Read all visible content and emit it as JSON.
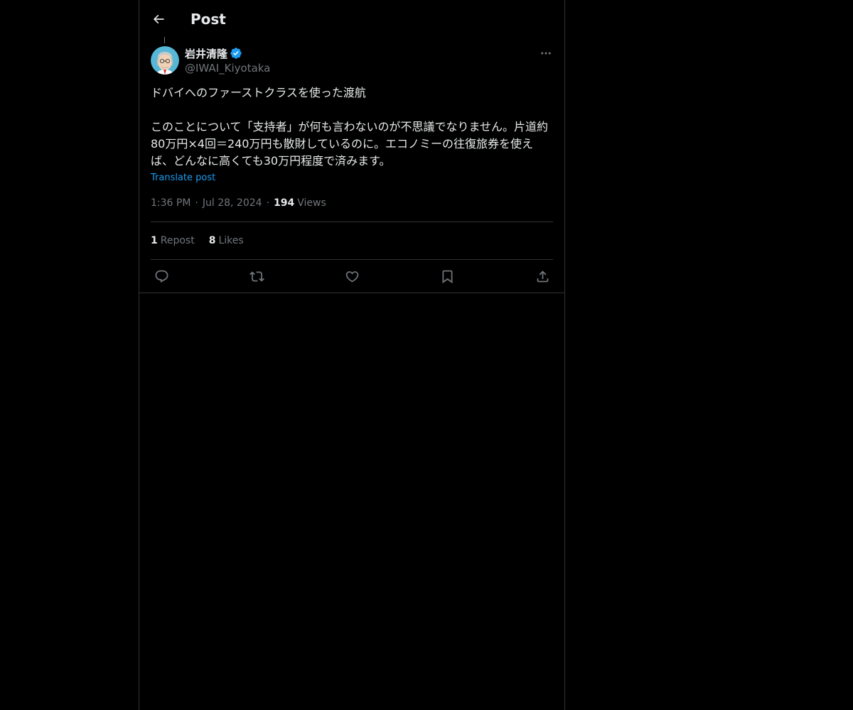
{
  "header": {
    "title": "Post",
    "back_icon": "arrow-left-icon"
  },
  "author": {
    "display_name": "岩井清隆",
    "handle": "@IWAI_Kiyotaka",
    "verified_icon": "verified-badge-icon",
    "verified_color": "#1d9bf0"
  },
  "post": {
    "text": "ドバイへのファーストクラスを使った渡航\n\nこのことについて「支持者」が何も言わないのが不思議でなりません。片道約80万円×4回＝240万円も散財しているのに。エコノミーの往復旅券を使えば、どんなに高くても30万円程度で済みます。",
    "translate_label": "Translate post",
    "time": "1:36 PM",
    "date": "Jul 28, 2024",
    "separator": "·",
    "views_count": "194",
    "views_label": "Views"
  },
  "stats": {
    "reposts_count": "1",
    "reposts_label": "Repost",
    "likes_count": "8",
    "likes_label": "Likes"
  },
  "actions": [
    {
      "icon": "reply-icon"
    },
    {
      "icon": "repost-icon"
    },
    {
      "icon": "like-icon"
    },
    {
      "icon": "bookmark-icon"
    },
    {
      "icon": "share-icon"
    }
  ],
  "colors": {
    "background": "#000000",
    "text": "#e7e9ea",
    "muted": "#71767b",
    "link": "#1d9bf0",
    "border": "#2f3336"
  }
}
